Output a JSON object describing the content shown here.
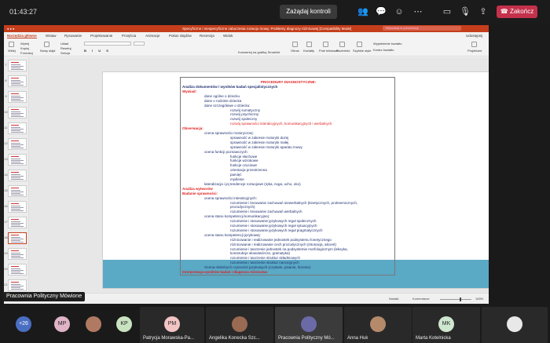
{
  "topbar": {
    "time": "01:43:27",
    "request_control": "Zażądaj kontroli",
    "end_call": "Zakończ",
    "icons": [
      "people-icon",
      "chat-icon",
      "react-icon",
      "more-icon",
      "camera-off-icon",
      "mic-off-icon",
      "share-screen-icon"
    ],
    "end_color": "#c4314b"
  },
  "app": {
    "doc_title": "Specyficzne i niespecyficzne zaburzenia rozwoju mowy. Problemy diagnozy różnicowej [Compatibility Mode]",
    "search_placeholder": "Wyszukaj w prezentacji",
    "accent": "#c43e1c",
    "tabs": [
      "Narzędzia główne",
      "Wstaw",
      "Rysowanie",
      "Projektowanie",
      "Przejścia",
      "Animacje",
      "Pokaz slajdów",
      "Recenzja",
      "Widok"
    ],
    "share_label": "Udostępnij",
    "ribbon": {
      "paste": "Wklej",
      "cut": "Wytnij",
      "copy": "Kopiuj",
      "format": "Formatuj",
      "new_slide": "Nowy slajd",
      "layout": "Układ",
      "reset": "Resetuj",
      "section": "Sekcja",
      "convert": "Konwertuj na grafikę SmartArt",
      "picture": "Obraz",
      "shapes": "Kształty",
      "textbox": "Pole tekstowe",
      "arrange": "Rozmieść",
      "quick_styles": "Szybkie style",
      "fill": "Wypełnienie kształtu",
      "outline": "Kontur kształtu",
      "design_ideas": "Projektant"
    }
  },
  "thumbnails": [
    "7",
    "8",
    "9",
    "10",
    "11",
    "12",
    "13",
    "14",
    "15",
    "16",
    "17",
    "18",
    "19",
    "20",
    "21"
  ],
  "slide": {
    "title": "PROCEDURY DIAGNOSTYCZNE:",
    "lines": [
      {
        "t": "Analiza dokumentów i wyników badań specjalistycznych",
        "x": 2,
        "c": "b"
      },
      {
        "t": "Wywiad:",
        "x": 2,
        "c": "red b"
      },
      {
        "t": "dane ogólne o dziecku",
        "x": 30,
        "c": ""
      },
      {
        "t": "dane o rodzinie dziecka",
        "x": 30,
        "c": ""
      },
      {
        "t": "dane szczegółowe o dziecku:",
        "x": 30,
        "c": ""
      },
      {
        "t": "rozwój somatyczny",
        "x": 63,
        "c": ""
      },
      {
        "t": "rozwój psychiczny",
        "x": 63,
        "c": ""
      },
      {
        "t": "rozwój społeczny",
        "x": 63,
        "c": ""
      },
      {
        "t": "rozwój sprawności interakcyjnych, komunikacyjnych i werbalnych",
        "x": 63,
        "c": "red"
      },
      {
        "t": "Obserwacja:",
        "x": 2,
        "c": "red b"
      },
      {
        "t": "ocena sprawności motorycznej:",
        "x": 30,
        "c": ""
      },
      {
        "t": "sprawność w zakresie motoryki dużej",
        "x": 63,
        "c": ""
      },
      {
        "t": "sprawność w zakresie motoryki małej",
        "x": 63,
        "c": ""
      },
      {
        "t": "sprawność w zakresie motoryki aparatu mowy",
        "x": 63,
        "c": ""
      },
      {
        "t": "ocena funkcji poznawczych:",
        "x": 30,
        "c": ""
      },
      {
        "t": "funkcje słuchowe",
        "x": 63,
        "c": ""
      },
      {
        "t": "funkcje wzrokowe",
        "x": 63,
        "c": ""
      },
      {
        "t": "funkcje czuciowe",
        "x": 63,
        "c": ""
      },
      {
        "t": "orientacja przestrzenna",
        "x": 63,
        "c": ""
      },
      {
        "t": "pamięć",
        "x": 63,
        "c": ""
      },
      {
        "t": "myślenie",
        "x": 63,
        "c": ""
      },
      {
        "t": "lateralizacja i jej tendencje rozwojowe (ręka, noga, ucho, oko)",
        "x": 30,
        "c": ""
      },
      {
        "t": "Analiza wytworów",
        "x": 2,
        "c": "red b"
      },
      {
        "t": "Badanie sprawności:",
        "x": 2,
        "c": "red b"
      },
      {
        "t": "ocena sprawności interakcyjnych:",
        "x": 30,
        "c": ""
      },
      {
        "t": "rozumienie i kreowanie zachowań niewerbalnych (kinetycznych, proksemicznych,",
        "x": 63,
        "c": ""
      },
      {
        "t": "prozodycznych)",
        "x": 63,
        "c": ""
      },
      {
        "t": "rozumienie i kreowanie zachowań werbalnych",
        "x": 63,
        "c": ""
      },
      {
        "t": "ocena stanu kompetencji komunikacyjnej:",
        "x": 30,
        "c": ""
      },
      {
        "t": "rozumienie i stosowanie językowych reguł społecznych",
        "x": 63,
        "c": ""
      },
      {
        "t": "rozumienie i stosowanie językowych reguł sytuacyjnych",
        "x": 63,
        "c": ""
      },
      {
        "t": "rozumienie i stosowanie językowych reguł pragmatycznych",
        "x": 63,
        "c": ""
      },
      {
        "t": "ocena stanu kompetencji językowej:",
        "x": 30,
        "c": ""
      },
      {
        "t": "różnicowanie i realizowanie jednostek podsystemu fonetycznego",
        "x": 63,
        "c": ""
      },
      {
        "t": "różnicowanie i realizowanie cech prozodycznych (intonacja, akcent)",
        "x": 63,
        "c": ""
      },
      {
        "t": "rozumienie i tworzenie jednostek na podsystemie morfologicznym (leksyka,",
        "x": 63,
        "c": ""
      },
      {
        "t": "konstrukcje słowotwórcze, gramatyka)",
        "x": 63,
        "c": ""
      },
      {
        "t": "rozumienie i tworzenie struktur składniowych",
        "x": 63,
        "c": ""
      },
      {
        "t": "rozumienie i tworzenie struktur narracyjnych",
        "x": 63,
        "c": ""
      },
      {
        "t": "Ocena niektórych czynności językowych (czytanie, pisanie, liczenie)",
        "x": 30,
        "c": ""
      },
      {
        "t": "Interpretacja wyników badań i diagnoza różnicowa",
        "x": 2,
        "c": "red b"
      }
    ]
  },
  "status": {
    "slide_info": "Slajd 18 z 21",
    "language": "Polski",
    "notes": "Notatki",
    "comments": "Komentarze",
    "zoom": "165%"
  },
  "presenter_name": "Pracownia Polityczny Mówione",
  "participants": [
    {
      "label": "",
      "initials": "+26",
      "color": "#4a6fc2"
    },
    {
      "label": "",
      "initials": "MP",
      "color": "#e0b3c7"
    },
    {
      "label": "",
      "initials": "",
      "color": "#b07a62"
    },
    {
      "label": "",
      "initials": "KP",
      "color": "#c9e3c0"
    },
    {
      "label": "Patrycja Morawska-Pa...",
      "initials": "PM",
      "color": "#f2c4c4"
    },
    {
      "label": "Angelika Konecka Szc...",
      "initials": "",
      "color": "#9a6a52"
    },
    {
      "label": "Pracownia Polityczny Mó...",
      "initials": "",
      "color": "#6a6aa6"
    },
    {
      "label": "Anna Huk",
      "initials": "",
      "color": "#b58a6a"
    },
    {
      "label": "Marta Kotelnicka",
      "initials": "MK",
      "color": "#cfe6cf"
    },
    {
      "label": "",
      "initials": "",
      "color": "#e8e8e8"
    }
  ]
}
